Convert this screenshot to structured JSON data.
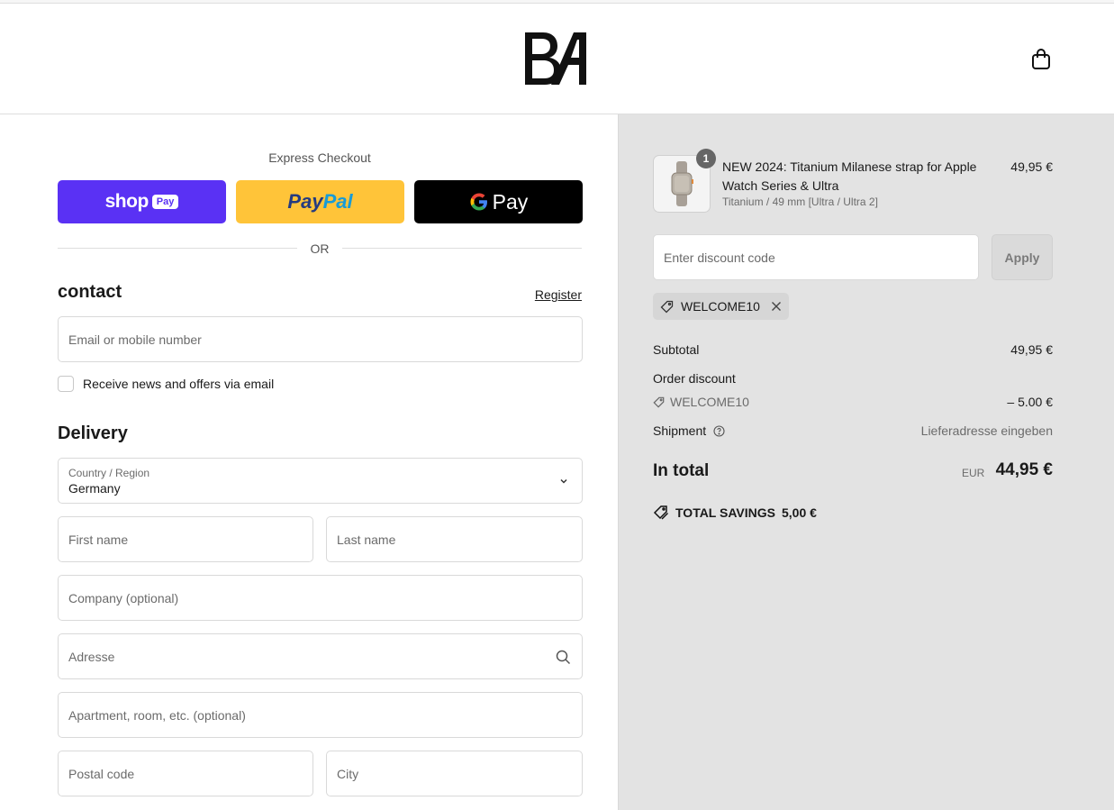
{
  "header": {
    "logo_text": "BA",
    "cart_icon": "shopping-bag-icon"
  },
  "express": {
    "title": "Express Checkout",
    "shop_pay_label": "shop",
    "shop_pay_box": "Pay",
    "paypal_pay": "Pay",
    "paypal_pal": "Pal",
    "gpay_label": "Pay",
    "or_label": "OR"
  },
  "contact": {
    "title": "contact",
    "register_link": "Register",
    "email_placeholder": "Email or mobile number",
    "newsletter_label": "Receive news and offers via email"
  },
  "delivery": {
    "title": "Delivery",
    "country_label": "Country / Region",
    "country_value": "Germany",
    "first_name_placeholder": "First name",
    "last_name_placeholder": "Last name",
    "company_placeholder": "Company (optional)",
    "address_placeholder": "Adresse",
    "apartment_placeholder": "Apartment, room, etc. (optional)",
    "postal_placeholder": "Postal code",
    "city_placeholder": "City"
  },
  "order": {
    "item": {
      "quantity": "1",
      "name": "NEW 2024: Titanium Milanese strap for Apple Watch Series & Ultra",
      "variant": "Titanium / 49 mm [Ultra / Ultra 2]",
      "price": "49,95 €"
    },
    "discount_placeholder": "Enter discount code",
    "apply_label": "Apply",
    "applied_code": "WELCOME10",
    "subtotal_label": "Subtotal",
    "subtotal_value": "49,95 €",
    "order_discount_label": "Order discount",
    "discount_code": "WELCOME10",
    "discount_value": "– 5.00 €",
    "shipment_label": "Shipment",
    "shipment_value": "Lieferadresse eingeben",
    "total_label": "In total",
    "total_currency": "EUR",
    "total_value": "44,95 €",
    "savings_label": "TOTAL SAVINGS",
    "savings_value": "5,00 €"
  },
  "colors": {
    "shop_pay": "#5a31f4",
    "paypal": "#ffc439",
    "gpay": "#000000",
    "summary_bg": "#e3e3e3"
  }
}
